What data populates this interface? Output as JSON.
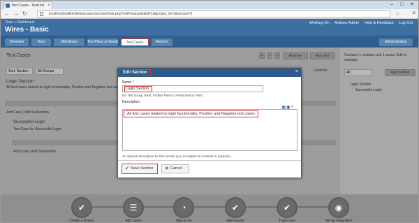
{
  "browser": {
    "tab_title": "Test Cases - TestLink",
    "url": "localhost/testlink/lib/testcases/archiveData.php?edit=testsuite&id=1&tproject_id=1&version=1",
    "window_controls": "– □ ✕"
  },
  "header": {
    "breadcrumb": "Tests » Dashboard",
    "project_title": "Wires - Basic",
    "user_items": [
      "Working On",
      "Actions Admin",
      "Help & Feedback",
      "Log Out"
    ]
  },
  "nav": {
    "tabs": [
      "Overview",
      "Tests",
      "Milestones",
      "Test Plans & Results",
      "Test Cases",
      "Reports"
    ],
    "active": "Test Cases",
    "admin": "Administration"
  },
  "background": {
    "title": "Test Cases",
    "section_title": "Login Section",
    "section_desc": "All test cases related to login functionality, Positive and Negative test cases",
    "add_case": "Add Case | Add Subsection",
    "case_title": "Successful Login",
    "case_desc": "Test Case for Successful Login",
    "add_case2": "Add Case | Add Subsection",
    "toolbar_btns": [
      "Reorder",
      "Run Test"
    ],
    "sort_select": "Sort: Section",
    "view_select": "All Groups",
    "columns_label": "Columns",
    "right_title": "Contains 1 sections and 1 cases. Edit to navigate.",
    "right_select": "All",
    "right_add_btn": "Add Section",
    "tree_root": "Login Section",
    "tree_child": "Successful Login"
  },
  "modal": {
    "title": "Edit Section",
    "name_label": "Name *",
    "name_value": "Login Section",
    "name_hint": "Ex: Test Group Tests, Further Plans or Performance Tests",
    "desc_label": "Description",
    "desc_value": "All test cases related to login functionality, Positive and Negative test cases",
    "desc_hint": "An optional description for this section (e.g. to explain its contents or purpose).",
    "save_label": "Save Section",
    "cancel_label": "Cancel"
  },
  "workflow": {
    "steps": [
      "Create a project",
      "Add cases",
      "Start a run",
      "Add results",
      "Track runs",
      "Set up integration"
    ]
  }
}
